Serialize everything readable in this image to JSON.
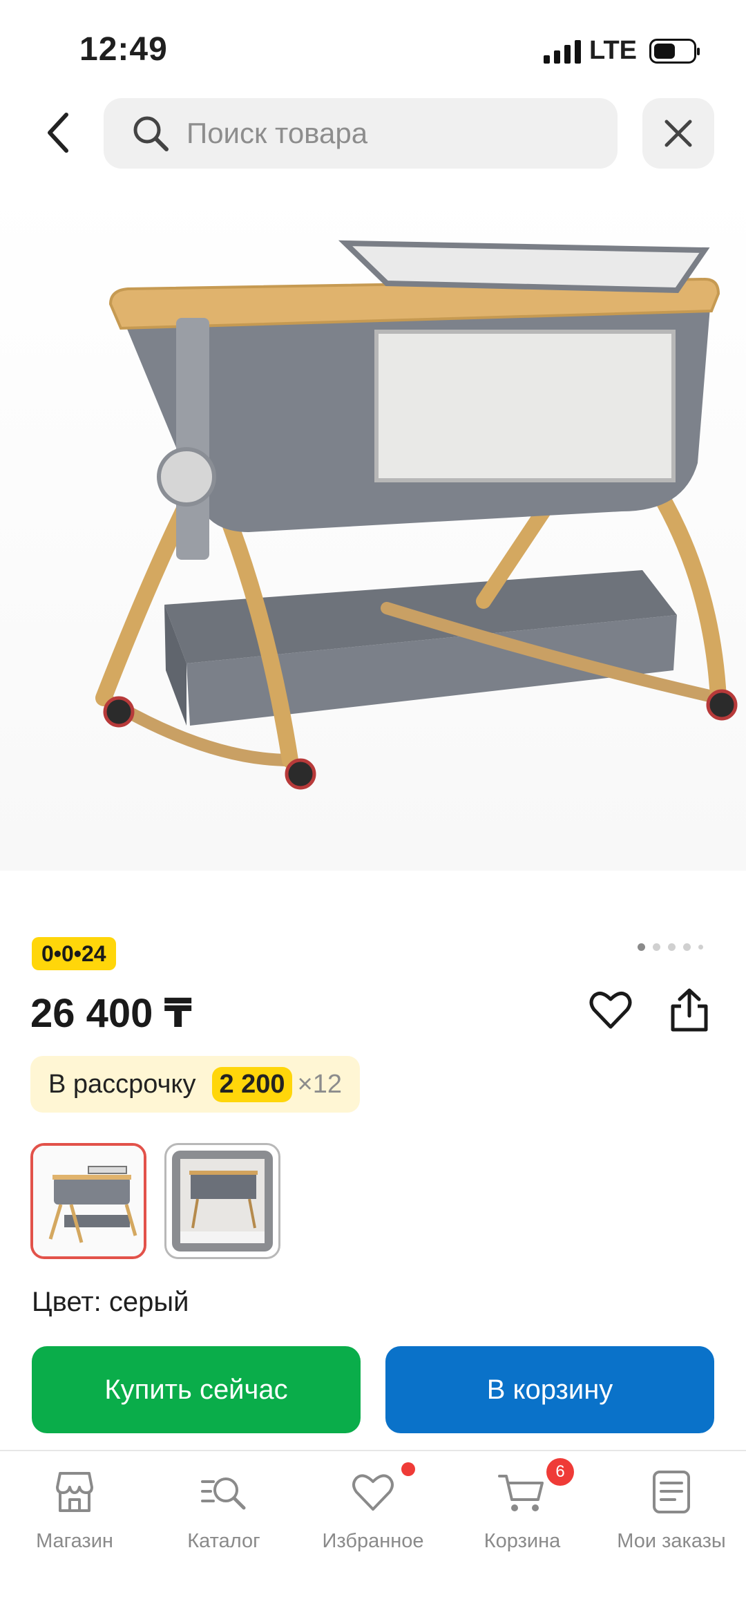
{
  "status_bar": {
    "time": "12:49",
    "network": "LTE"
  },
  "search": {
    "placeholder": "Поиск товара"
  },
  "product": {
    "promo_badge": "0•0•24",
    "price": "26 400 ₸",
    "installment": {
      "label": "В рассрочку",
      "amount": "2 200",
      "times": "×12"
    },
    "color_label": "Цвет: серый",
    "gallery": {
      "total_images": 5,
      "active_index": 1
    }
  },
  "actions": {
    "buy_now": "Купить сейчас",
    "add_to_cart": "В корзину"
  },
  "bottom_nav": {
    "items": [
      {
        "label": "Магазин",
        "icon": "store-icon"
      },
      {
        "label": "Каталог",
        "icon": "catalog-search-icon"
      },
      {
        "label": "Избранное",
        "icon": "heart-icon"
      },
      {
        "label": "Корзина",
        "icon": "cart-icon",
        "badge": "6"
      },
      {
        "label": "Мои заказы",
        "icon": "orders-icon"
      }
    ]
  },
  "colors": {
    "accent_yellow": "#ffd60a",
    "buy_green": "#0aad4a",
    "cart_blue": "#0a72c9",
    "badge_red": "#ef3b37"
  }
}
